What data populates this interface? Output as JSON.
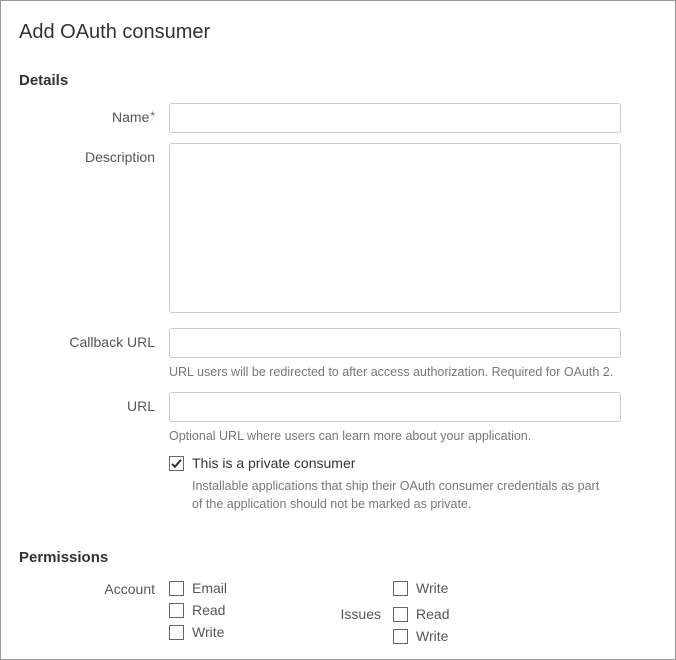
{
  "title": "Add OAuth consumer",
  "sections": {
    "details": {
      "heading": "Details",
      "name": {
        "label": "Name",
        "required": true,
        "value": ""
      },
      "description": {
        "label": "Description",
        "value": ""
      },
      "callback": {
        "label": "Callback URL",
        "value": "",
        "hint": "URL users will be redirected to after access authorization. Required for OAuth 2."
      },
      "url": {
        "label": "URL",
        "value": "",
        "hint": "Optional URL where users can learn more about your application."
      },
      "private": {
        "checked": true,
        "label": "This is a private consumer",
        "hint": "Installable applications that ship their OAuth consumer credentials as part of the application should not be marked as private."
      }
    },
    "permissions": {
      "heading": "Permissions",
      "groups": [
        {
          "name": "Account",
          "items": [
            {
              "label": "Email",
              "checked": false
            },
            {
              "label": "Read",
              "checked": false
            },
            {
              "label": "Write",
              "checked": false
            }
          ]
        },
        {
          "name": "",
          "items": [
            {
              "label": "Write",
              "checked": false
            }
          ]
        },
        {
          "name": "Issues",
          "items": [
            {
              "label": "Read",
              "checked": false
            },
            {
              "label": "Write",
              "checked": false
            }
          ]
        }
      ]
    }
  }
}
